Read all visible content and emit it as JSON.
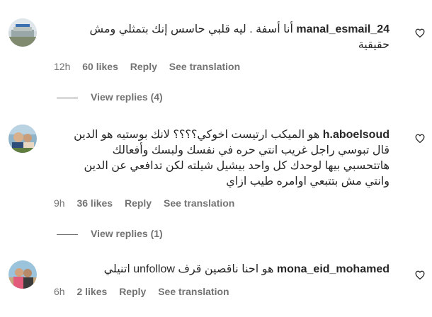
{
  "comments": [
    {
      "username": "manal_esmail_24",
      "lines": [
        "أنا أسفة . ليه قلبي حاسس إنك بتمثلي ومش",
        "حقيقية"
      ],
      "time": "12h",
      "likes": "60 likes",
      "reply_label": "Reply",
      "translation_label": "See translation",
      "view_replies": "View replies (4)"
    },
    {
      "username": "h.aboelsoud",
      "lines": [
        "هو الميكب ارتيست اخوكي؟؟؟؟ لانك بوستيه هو الدين",
        "قال تبوسي راجل غريب انتي حره في نفسك ولبسك وأفعالك",
        "هاتتحسبي بيها لوحدك كل واحد بيشيل شيلته لكن تدافعي عن الدين",
        "وانتي مش بتتبعي اوامره طيب ازاي"
      ],
      "time": "9h",
      "likes": "36 likes",
      "reply_label": "Reply",
      "translation_label": "See translation",
      "view_replies": "View replies (1)"
    },
    {
      "username": "mona_eid_mohamed",
      "text_before": "هو احنا ناقصين قرف",
      "text_ltr": "unfollow",
      "text_after": "اتنيلي",
      "time": "6h",
      "likes": "2 likes",
      "reply_label": "Reply",
      "translation_label": "See translation"
    }
  ],
  "icons": {
    "heart": "heart-outline-icon"
  },
  "colors": {
    "text": "#262626",
    "secondary": "#737373"
  }
}
